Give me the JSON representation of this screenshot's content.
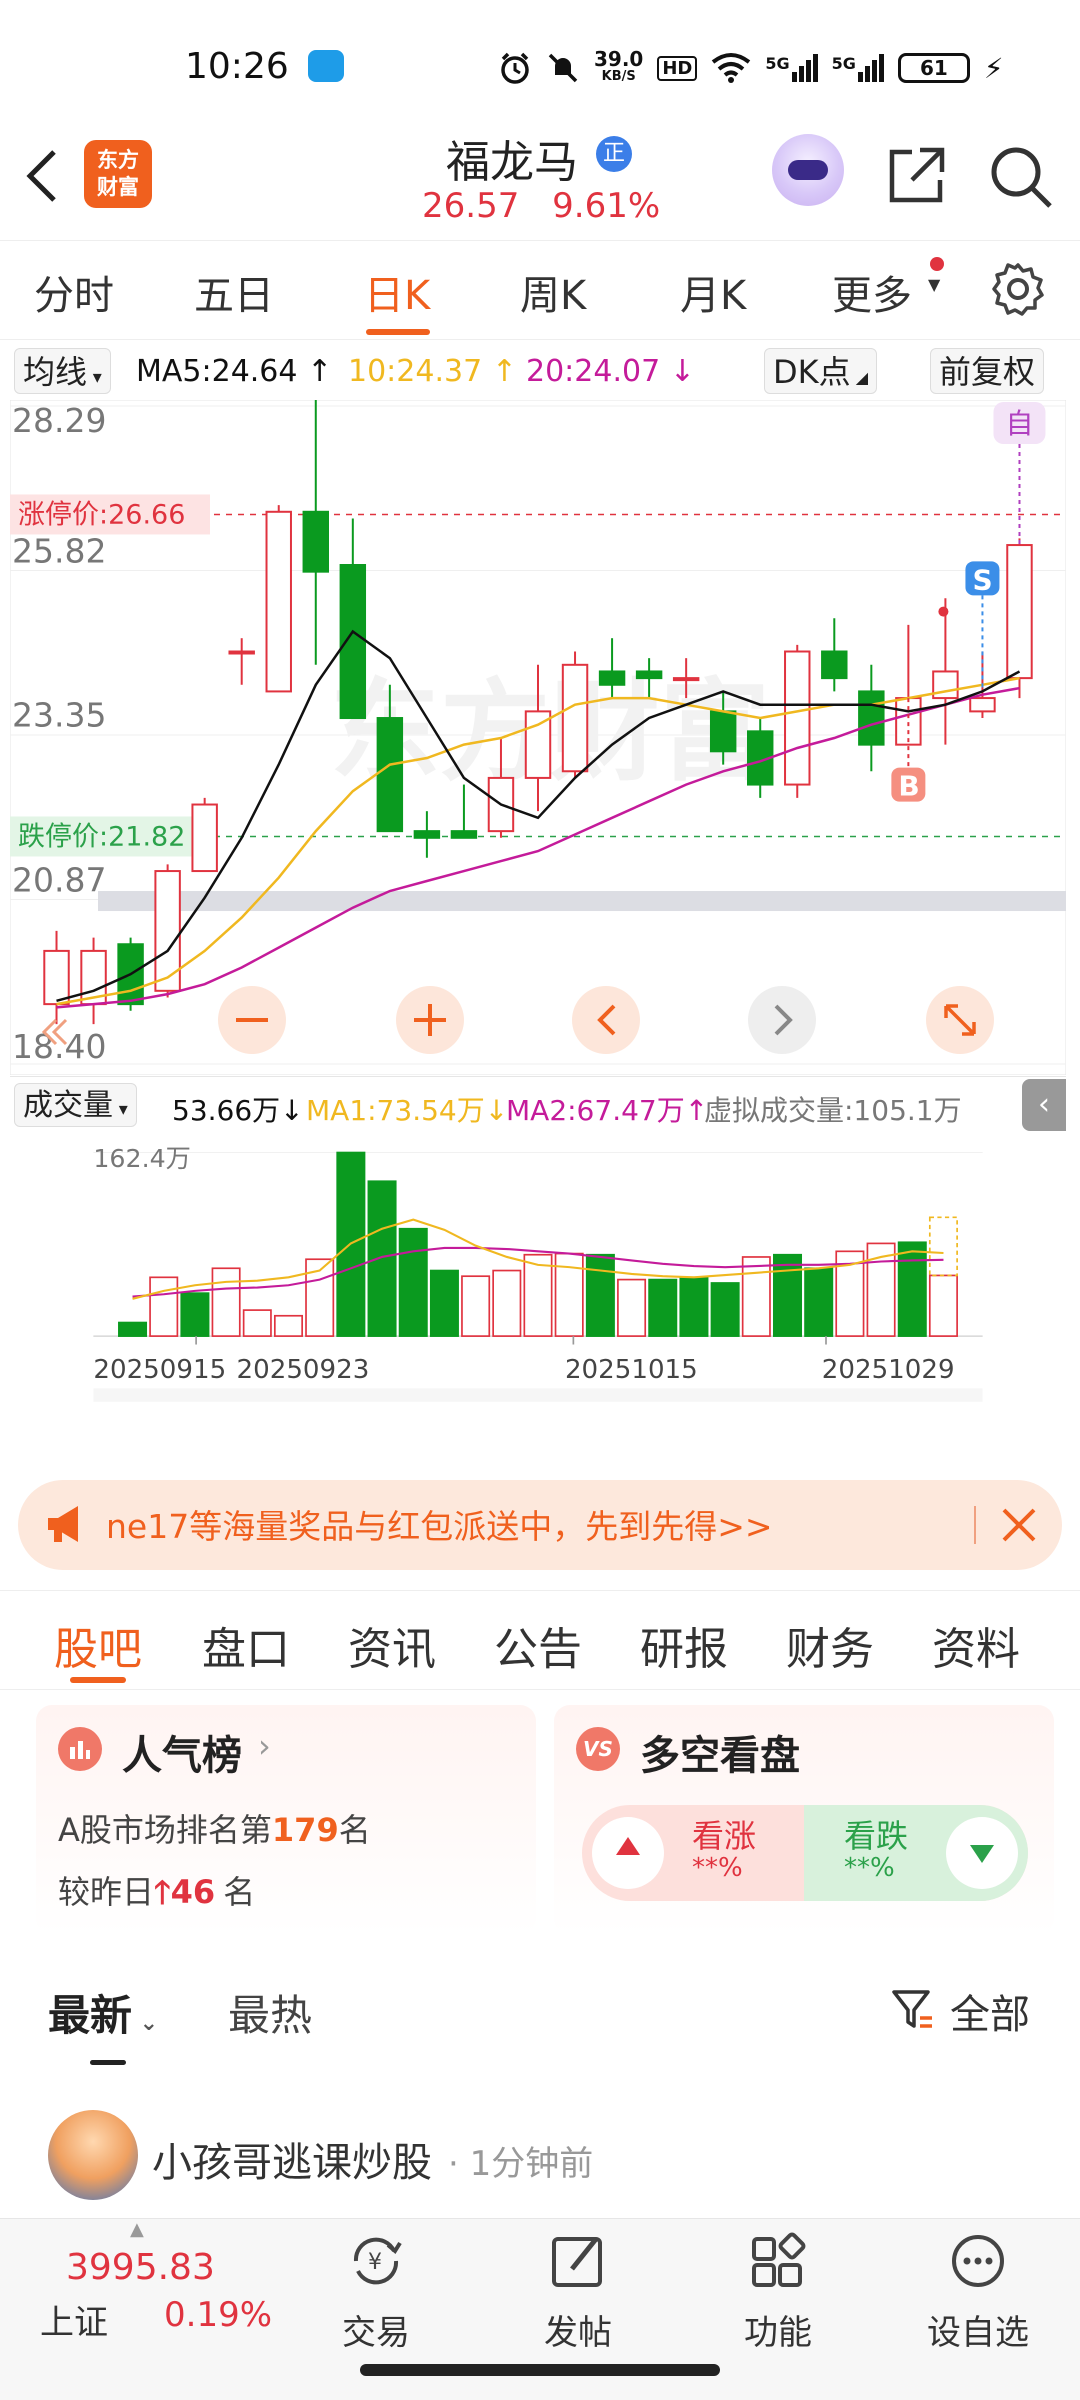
{
  "status_bar": {
    "time": "10:26",
    "net_speed_value": "39.0",
    "net_speed_unit": "KB/S",
    "hd_label": "HD",
    "signal1": "5G",
    "signal2": "5G",
    "battery": "61"
  },
  "header": {
    "logo_line1": "东方",
    "logo_line2": "财富",
    "stock_name": "福龙马",
    "stock_badge": "正",
    "price": "26.57",
    "change_pct": "9.61%"
  },
  "period_tabs": [
    {
      "label": "分时"
    },
    {
      "label": "五日"
    },
    {
      "label": "日K"
    },
    {
      "label": "周K"
    },
    {
      "label": "月K"
    },
    {
      "label": "更多"
    }
  ],
  "ma_legend": {
    "selector": "均线",
    "ma5": "MA5:24.64",
    "ma10": "10:24.37",
    "ma20": "20:24.07",
    "dk_button": "DK点",
    "adjust_button": "前复权"
  },
  "kline": {
    "price_labels": [
      "28.29",
      "25.82",
      "23.35",
      "20.87",
      "18.40"
    ],
    "limit_up_label": "涨停价:26.66",
    "limit_down_label": "跌停价:21.82",
    "marker_self": "自",
    "marker_s": "S",
    "marker_b": "B"
  },
  "volume": {
    "selector": "成交量",
    "vol_value": "53.66万",
    "ma1": "MA1:73.54万",
    "ma2": "MA2:67.47万",
    "virtual": "虚拟成交量:105.1万",
    "max_label": "162.4万",
    "dates": [
      "20250915",
      "20250923",
      "20251015",
      "20251029"
    ]
  },
  "chart_data": {
    "type": "candlestick",
    "ylim": [
      18.4,
      28.29
    ],
    "limit_up": 26.66,
    "limit_down": 21.82,
    "candles": [
      {
        "o": 19.3,
        "c": 20.1,
        "h": 20.4,
        "l": 19.0
      },
      {
        "o": 19.3,
        "c": 20.1,
        "h": 20.3,
        "l": 19.0
      },
      {
        "o": 20.2,
        "c": 19.3,
        "h": 20.3,
        "l": 19.2
      },
      {
        "o": 19.5,
        "c": 21.3,
        "h": 21.4,
        "l": 19.4
      },
      {
        "o": 21.3,
        "c": 22.3,
        "h": 22.4,
        "l": 21.3
      },
      {
        "o": 24.6,
        "c": 24.6,
        "h": 24.8,
        "l": 24.1
      },
      {
        "o": 24.0,
        "c": 26.7,
        "h": 26.8,
        "l": 24.0
      },
      {
        "o": 26.7,
        "c": 25.8,
        "h": 28.8,
        "l": 24.4
      },
      {
        "o": 25.9,
        "c": 23.6,
        "h": 26.6,
        "l": 23.6
      },
      {
        "o": 23.6,
        "c": 21.9,
        "h": 24.1,
        "l": 21.9
      },
      {
        "o": 21.9,
        "c": 21.8,
        "h": 22.2,
        "l": 21.5
      },
      {
        "o": 21.9,
        "c": 21.8,
        "h": 22.6,
        "l": 21.8
      },
      {
        "o": 21.9,
        "c": 22.7,
        "h": 23.3,
        "l": 21.8
      },
      {
        "o": 22.7,
        "c": 23.7,
        "h": 24.4,
        "l": 22.2
      },
      {
        "o": 22.8,
        "c": 24.4,
        "h": 24.6,
        "l": 22.7
      },
      {
        "o": 24.3,
        "c": 24.1,
        "h": 24.8,
        "l": 23.9
      },
      {
        "o": 24.3,
        "c": 24.2,
        "h": 24.5,
        "l": 23.9
      },
      {
        "o": 24.2,
        "c": 24.2,
        "h": 24.5,
        "l": 23.9
      },
      {
        "o": 23.7,
        "c": 23.1,
        "h": 24.0,
        "l": 22.9
      },
      {
        "o": 23.4,
        "c": 22.6,
        "h": 23.6,
        "l": 22.4
      },
      {
        "o": 22.6,
        "c": 24.6,
        "h": 24.7,
        "l": 22.4
      },
      {
        "o": 24.6,
        "c": 24.2,
        "h": 25.1,
        "l": 24.0
      },
      {
        "o": 24.0,
        "c": 23.2,
        "h": 24.4,
        "l": 22.8
      },
      {
        "o": 23.2,
        "c": 23.9,
        "h": 25.0,
        "l": 23.2
      },
      {
        "o": 23.9,
        "c": 24.3,
        "h": 25.4,
        "l": 23.2
      },
      {
        "o": 23.7,
        "c": 23.9,
        "h": 24.6,
        "l": 23.6
      },
      {
        "o": 24.2,
        "c": 26.2,
        "h": 26.3,
        "l": 23.9
      }
    ],
    "ma5": [
      19.35,
      19.5,
      19.75,
      20.1,
      20.9,
      21.8,
      22.9,
      24.1,
      24.9,
      24.5,
      23.6,
      22.7,
      22.3,
      22.1,
      22.7,
      23.2,
      23.6,
      23.8,
      24.0,
      23.8,
      23.8,
      23.8,
      23.8,
      23.7,
      23.8,
      24.0,
      24.3
    ],
    "ma10": [
      19.3,
      19.4,
      19.5,
      19.7,
      20.1,
      20.6,
      21.2,
      21.9,
      22.5,
      22.9,
      23.0,
      23.2,
      23.3,
      23.5,
      23.8,
      23.9,
      23.9,
      23.8,
      23.7,
      23.6,
      23.7,
      23.8,
      23.8,
      23.9,
      24.0,
      24.1,
      24.2
    ],
    "ma20": [
      19.25,
      19.3,
      19.35,
      19.45,
      19.6,
      19.85,
      20.15,
      20.45,
      20.75,
      21.0,
      21.15,
      21.3,
      21.45,
      21.6,
      21.85,
      22.1,
      22.35,
      22.6,
      22.8,
      22.95,
      23.15,
      23.3,
      23.5,
      23.65,
      23.8,
      23.95,
      24.05
    ],
    "volumes": [
      12,
      52,
      38,
      60,
      23,
      18,
      68,
      162.4,
      137,
      95,
      58,
      53,
      58,
      72,
      73,
      72,
      50,
      50,
      52,
      47,
      70,
      72,
      60,
      75,
      82,
      83,
      53.66
    ],
    "volume_up": [
      false,
      true,
      false,
      true,
      true,
      true,
      true,
      false,
      false,
      false,
      false,
      true,
      true,
      true,
      true,
      false,
      true,
      false,
      false,
      false,
      true,
      false,
      false,
      true,
      true,
      false,
      true
    ],
    "vol_ma1": [
      33,
      40,
      45,
      48,
      49,
      52,
      58,
      82,
      95,
      103,
      94,
      80,
      70,
      63,
      61,
      58,
      55,
      53,
      52,
      54,
      56,
      58,
      60,
      63,
      70,
      75,
      73.54
    ],
    "vol_ma2": [
      35,
      37,
      40,
      42,
      43,
      45,
      50,
      60,
      70,
      75,
      78,
      78,
      77,
      75,
      73,
      70,
      67,
      64,
      62,
      61,
      62,
      63,
      63,
      64,
      66,
      67,
      67.47
    ]
  },
  "banner": {
    "text": "ne17等海量奖品与红包派送中，先到先得>>"
  },
  "section_tabs": [
    {
      "label": "股吧"
    },
    {
      "label": "盘口"
    },
    {
      "label": "资讯"
    },
    {
      "label": "公告"
    },
    {
      "label": "研报"
    },
    {
      "label": "财务"
    },
    {
      "label": "资料"
    }
  ],
  "popularity_card": {
    "title": "人气榜",
    "rank_prefix": "A股市场排名第",
    "rank": "179",
    "rank_suffix": "名",
    "change_prefix": "较昨日",
    "change_value": "46",
    "change_suffix": "名"
  },
  "bull_bear_card": {
    "title": "多空看盘",
    "bull_label": "看涨",
    "bull_pct": "**%",
    "bear_label": "看跌",
    "bear_pct": "**%"
  },
  "feed_filter": {
    "latest": "最新",
    "hottest": "最热",
    "all": "全部"
  },
  "post": {
    "author": "小孩哥逃课炒股",
    "time": "1分钟前"
  },
  "bottom_bar": {
    "index_value": "3995.83",
    "index_name": "上证",
    "index_change": "0.19%",
    "trade": "交易",
    "post": "发帖",
    "functions": "功能",
    "watchlist": "设自选"
  },
  "colors": {
    "brand": "#f0601e",
    "up": "#e0333f",
    "down": "#0a9a1f",
    "ma5": "#111111",
    "ma10": "#f0b820",
    "ma20": "#c41b9a"
  }
}
